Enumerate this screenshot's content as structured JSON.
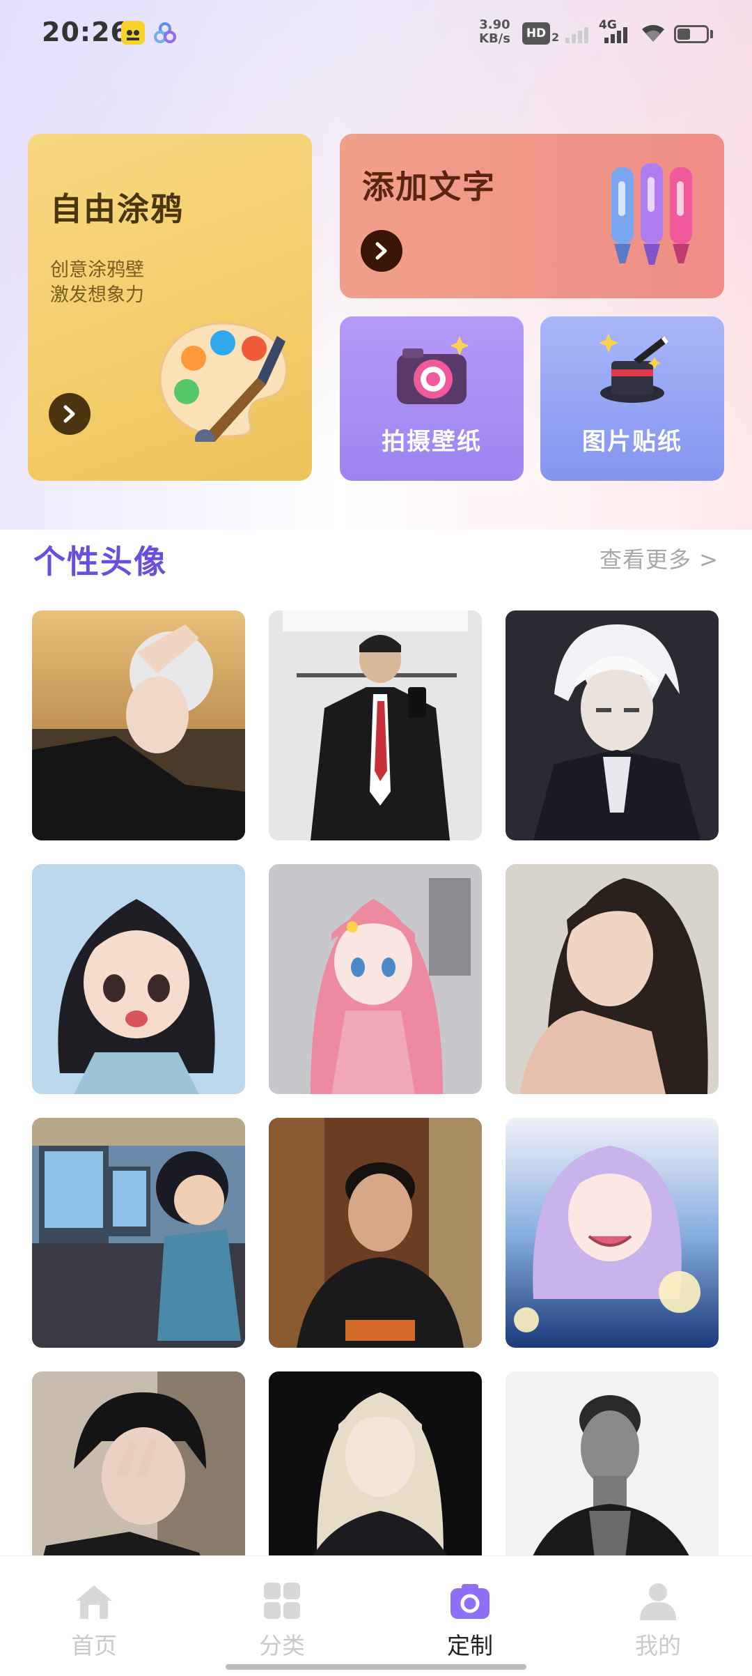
{
  "status_bar": {
    "time": "20:26",
    "net_speed_value": "3.90",
    "net_speed_unit": "KB/s",
    "hd_label": "HD",
    "hd_sub": "2",
    "network_type": "4G",
    "battery_level": 0.45
  },
  "features": {
    "doodle": {
      "title": "自由涂鸦",
      "subtitle_line1": "创意涂鸦壁",
      "subtitle_line2": "激发想象力",
      "icon": "palette-icon"
    },
    "add_text": {
      "title": "添加文字",
      "icon": "markers-icon"
    },
    "photo_wallpaper": {
      "label": "拍摄壁纸",
      "icon": "camera-icon"
    },
    "image_sticker": {
      "label": "图片贴纸",
      "icon": "magic-hat-icon"
    }
  },
  "section": {
    "title": "个性头像",
    "see_more": "查看更多 >"
  },
  "avatars": [
    {
      "name": "avatar-white-hair-sunset"
    },
    {
      "name": "avatar-mirror-selfie-suit"
    },
    {
      "name": "avatar-anime-white-hair-boy"
    },
    {
      "name": "avatar-anime-black-hair-girl"
    },
    {
      "name": "avatar-anime-pink-hair-girl"
    },
    {
      "name": "avatar-girl-portrait"
    },
    {
      "name": "avatar-anime-boy-computer"
    },
    {
      "name": "avatar-boy-portrait"
    },
    {
      "name": "avatar-anime-purple-hair-girl"
    },
    {
      "name": "avatar-boy-peace-sign"
    },
    {
      "name": "avatar-blonde-girl-night"
    },
    {
      "name": "avatar-bw-man-portrait"
    }
  ],
  "bottom_nav": [
    {
      "label": "首页",
      "icon": "home-icon",
      "active": false
    },
    {
      "label": "分类",
      "icon": "grid-icon",
      "active": false
    },
    {
      "label": "定制",
      "icon": "camera-icon",
      "active": true
    },
    {
      "label": "我的",
      "icon": "profile-icon",
      "active": false
    }
  ],
  "colors": {
    "accent": "#6a4fdc",
    "active_nav": "#8f6ff5",
    "inactive_nav": "#c9c9c9"
  }
}
